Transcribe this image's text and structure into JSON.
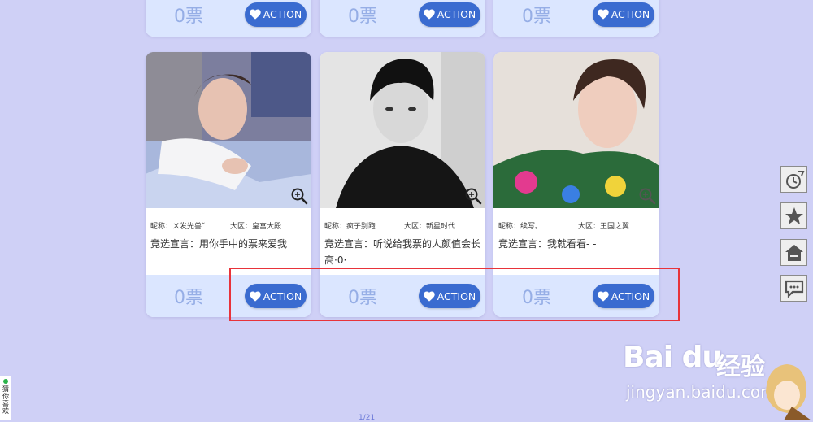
{
  "top_cards": [
    {
      "votes": "0票",
      "action_label": "ACTION"
    },
    {
      "votes": "0票",
      "action_label": "ACTION"
    },
    {
      "votes": "0票",
      "action_label": "ACTION"
    }
  ],
  "cards": [
    {
      "nickname": "昵称：ㄨ发光兽ˇ",
      "region": "大区：皇宫大殿",
      "slogan": "竞选宣言：用你手中的票来爱我",
      "votes": "0票",
      "action_label": "ACTION"
    },
    {
      "nickname": "昵称：疯子别跑",
      "region": "大区：新星时代",
      "slogan": "竞选宣言：听说给我票的人颜值会长高·0·",
      "votes": "0票",
      "action_label": "ACTION"
    },
    {
      "nickname": "昵称：续写。",
      "region": "大区：王国之翼",
      "slogan": "竞选宣言：我就看看- -",
      "votes": "0票",
      "action_label": "ACTION"
    }
  ],
  "sidebar": {
    "items": [
      {
        "icon": "clock-icon"
      },
      {
        "icon": "star-icon"
      },
      {
        "icon": "home-icon"
      },
      {
        "icon": "chat-icon"
      }
    ]
  },
  "guess_widget": {
    "label": "猜你喜欢"
  },
  "pagination": {
    "text": "1/21"
  },
  "watermark": {
    "brand": "Bai du",
    "cn": "经验",
    "url": "jingyan.baidu.com"
  },
  "colors": {
    "background": "#cfd0f6",
    "action": "#3a6bd0",
    "votebar": "#dbe6ff",
    "highlight": "#e8333a"
  }
}
